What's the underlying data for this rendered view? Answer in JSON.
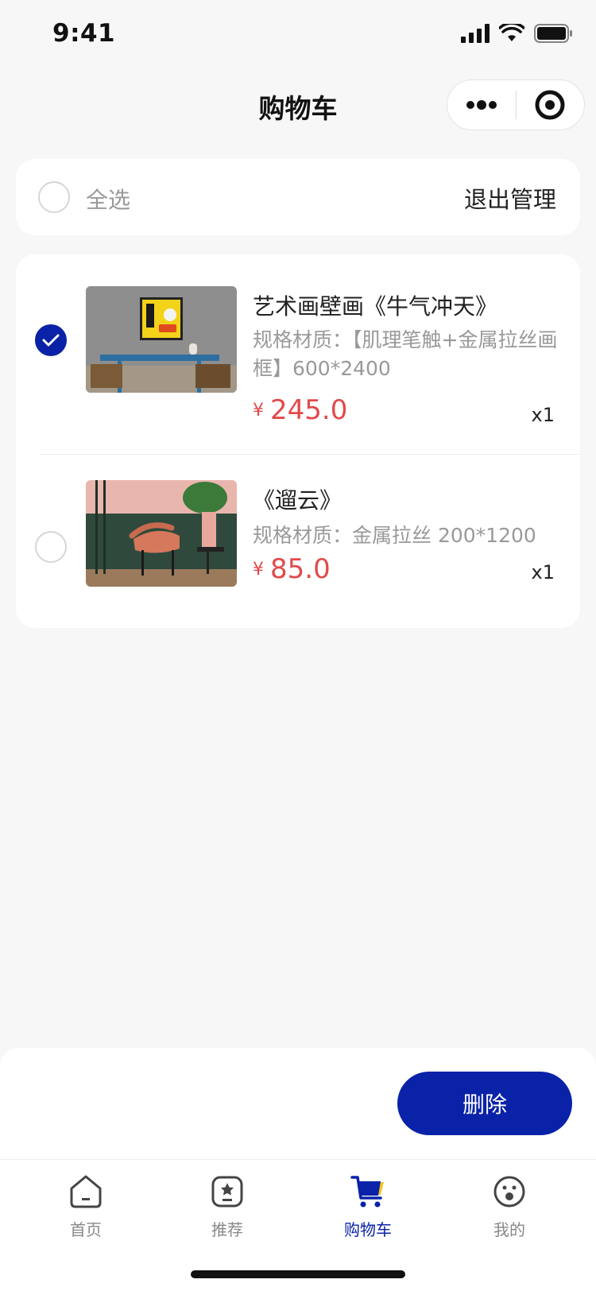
{
  "status_bar": {
    "time": "9:41"
  },
  "nav": {
    "title": "购物车"
  },
  "select_bar": {
    "select_all_label": "全选",
    "exit_manage_label": "退出管理"
  },
  "cart_items": [
    {
      "title": "艺术画壁画《牛气冲天》",
      "spec": "规格材质：【肌理笔触+金属拉丝画框】600*2400",
      "currency": "¥",
      "price": "245.0",
      "qty": "x1",
      "selected": true
    },
    {
      "title": "《遛云》",
      "spec": "规格材质：金属拉丝 200*1200",
      "currency": "¥",
      "price": "85.0",
      "qty": "x1",
      "selected": false
    }
  ],
  "action_bar": {
    "delete_label": "删除"
  },
  "tab_bar": {
    "items": [
      {
        "label": "首页",
        "icon": "home-icon",
        "active": false
      },
      {
        "label": "推荐",
        "icon": "star-box-icon",
        "active": false
      },
      {
        "label": "购物车",
        "icon": "cart-icon",
        "active": true
      },
      {
        "label": "我的",
        "icon": "smiley-icon",
        "active": false
      }
    ]
  },
  "colors": {
    "accent": "#0a22a8",
    "price": "#e14a4a",
    "background": "#f7f7f7"
  }
}
